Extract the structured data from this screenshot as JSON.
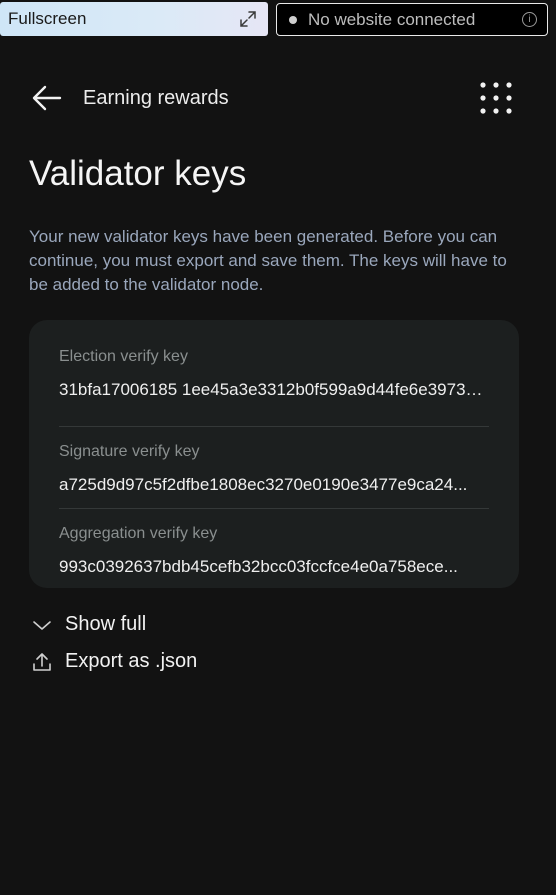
{
  "topbar": {
    "fullscreen_label": "Fullscreen",
    "connection_status": "No website connected",
    "info_glyph": "i"
  },
  "header": {
    "back_icon": "arrow-left-icon",
    "title": "Earning rewards",
    "menu_icon": "grid-dots-icon"
  },
  "page": {
    "title": "Validator keys",
    "description": "Your new validator keys have been generated. Before you can continue, you must export and save them. The keys will have to be added to the validator node."
  },
  "keys": [
    {
      "label": "Election verify key",
      "value": "31bfa17006185 1ee45a3e3312b0f599a9d44fe6e39737..."
    },
    {
      "label": "Signature verify key",
      "value": "a725d9d97c5f2dfbe1808ec3270e0190e3477e9ca24..."
    },
    {
      "label": "Aggregation verify key",
      "value": "993c0392637bdb45cefb32bcc03fccfce4e0a758ece..."
    }
  ],
  "actions": {
    "show_full": "Show full",
    "export": "Export as .json"
  },
  "colors": {
    "background": "#121212",
    "card": "#1c1f1f",
    "description_text": "#9aa7bc"
  }
}
